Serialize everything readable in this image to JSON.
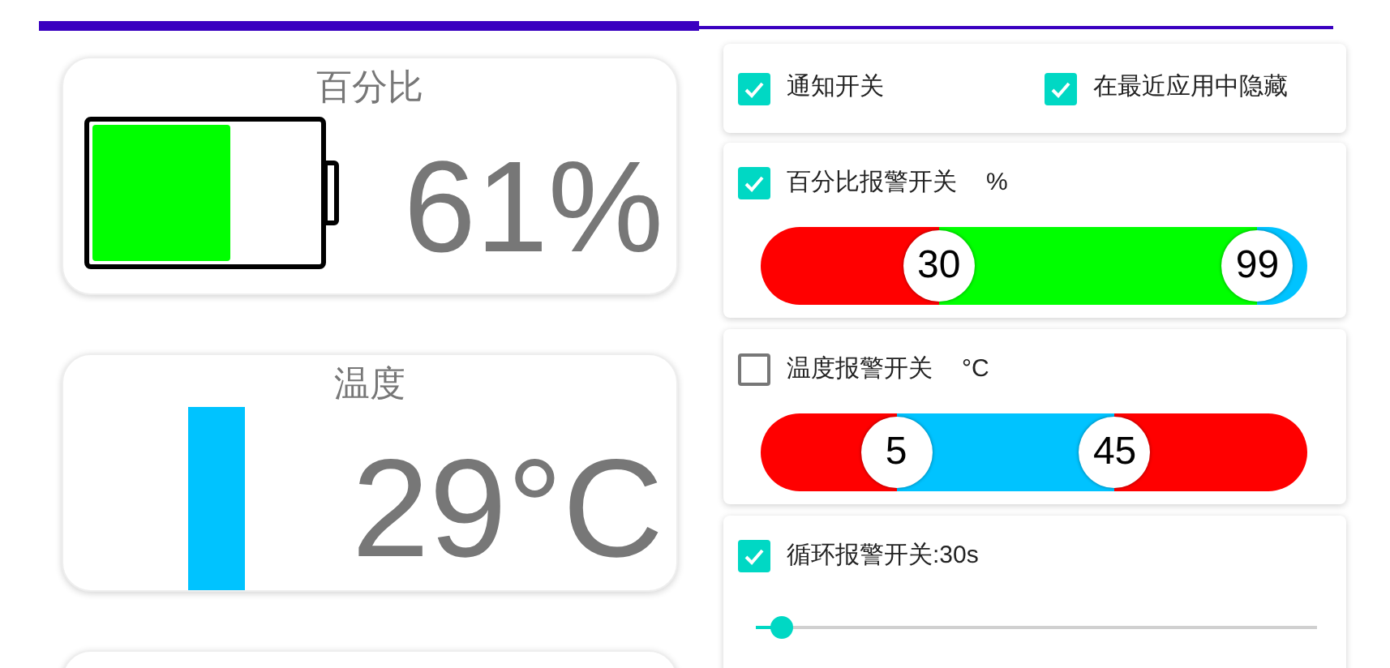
{
  "progress": {
    "level": 0.51
  },
  "left_cards": [
    {
      "kind": "battery",
      "title": "百分比",
      "level": 0.61,
      "reading": "61%"
    },
    {
      "kind": "thermometer",
      "title": "温度",
      "level": 0.94,
      "reading": "29°C"
    },
    {
      "kind": "stats"
    }
  ],
  "options": [
    {
      "label": "通知开关",
      "checked": true
    },
    {
      "label": "在最近应用中隐藏",
      "checked": true
    }
  ],
  "alarms": [
    {
      "kind": "range",
      "label": "百分比报警开关",
      "unit": "%",
      "checked": true,
      "low": {
        "value": "30",
        "level": 0.3
      },
      "high": {
        "value": "99",
        "level": 0.97
      },
      "segments": [
        {
          "color": "#ff0000"
        },
        {
          "color": "#00ff00"
        },
        {
          "color": "#00c3ff"
        }
      ]
    },
    {
      "kind": "range",
      "label": "温度报警开关",
      "unit": "°C",
      "checked": false,
      "low": {
        "value": "5",
        "level": 0.21
      },
      "high": {
        "value": "45",
        "level": 0.67
      },
      "segments": [
        {
          "color": "#ff0000"
        },
        {
          "color": "#00c3ff"
        },
        {
          "color": "#ff0000"
        }
      ]
    },
    {
      "kind": "slider",
      "label": "循环报警开关:30s",
      "checked": true,
      "level": 0.03
    }
  ]
}
